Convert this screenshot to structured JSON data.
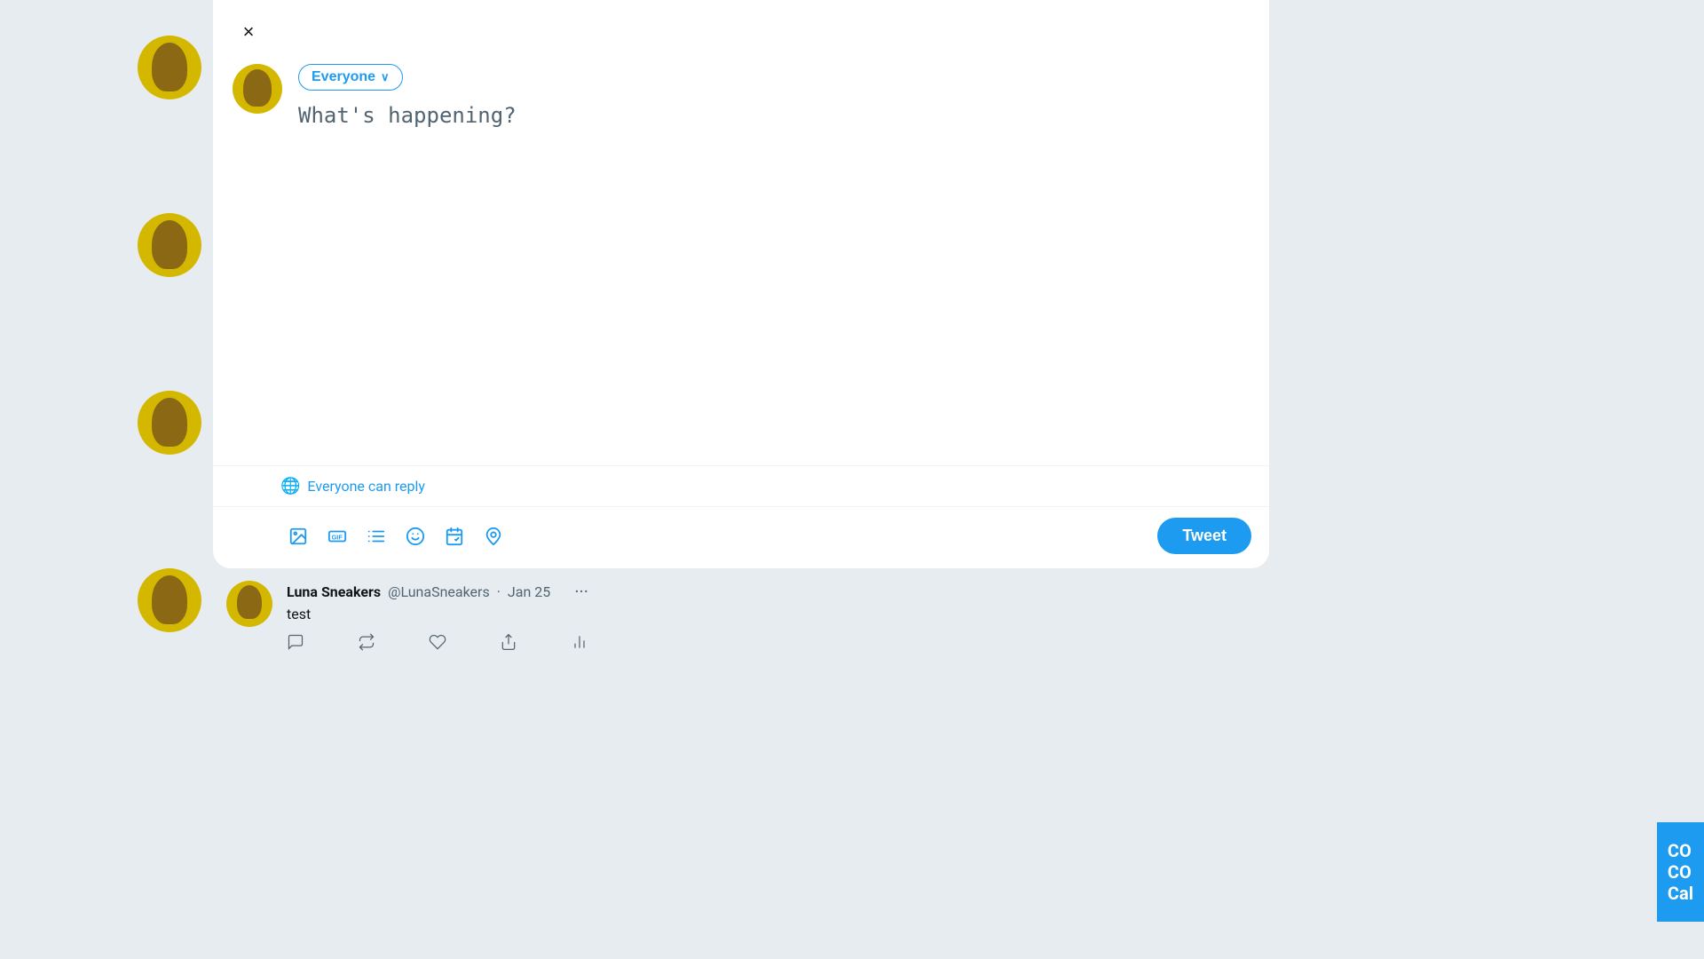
{
  "modal": {
    "close_label": "×",
    "audience_btn_label": "Everyone",
    "tweet_placeholder": "What's happening?",
    "reply_setting_label": "Everyone can reply",
    "tweet_btn_label": "Tweet"
  },
  "toolbar": {
    "image_icon": "🖼",
    "gif_icon": "GIF",
    "poll_icon": "📋",
    "emoji_icon": "🙂",
    "schedule_icon": "🗓",
    "location_icon": "📍"
  },
  "feed": {
    "tweet": {
      "name": "Luna Sneakers",
      "handle": "@LunaSneakers",
      "separator": "·",
      "date": "Jan 25",
      "text": "test",
      "more_icon": "···"
    }
  },
  "co_badge": {
    "line1": "CO",
    "line2": "CO",
    "line3": "Cal"
  }
}
